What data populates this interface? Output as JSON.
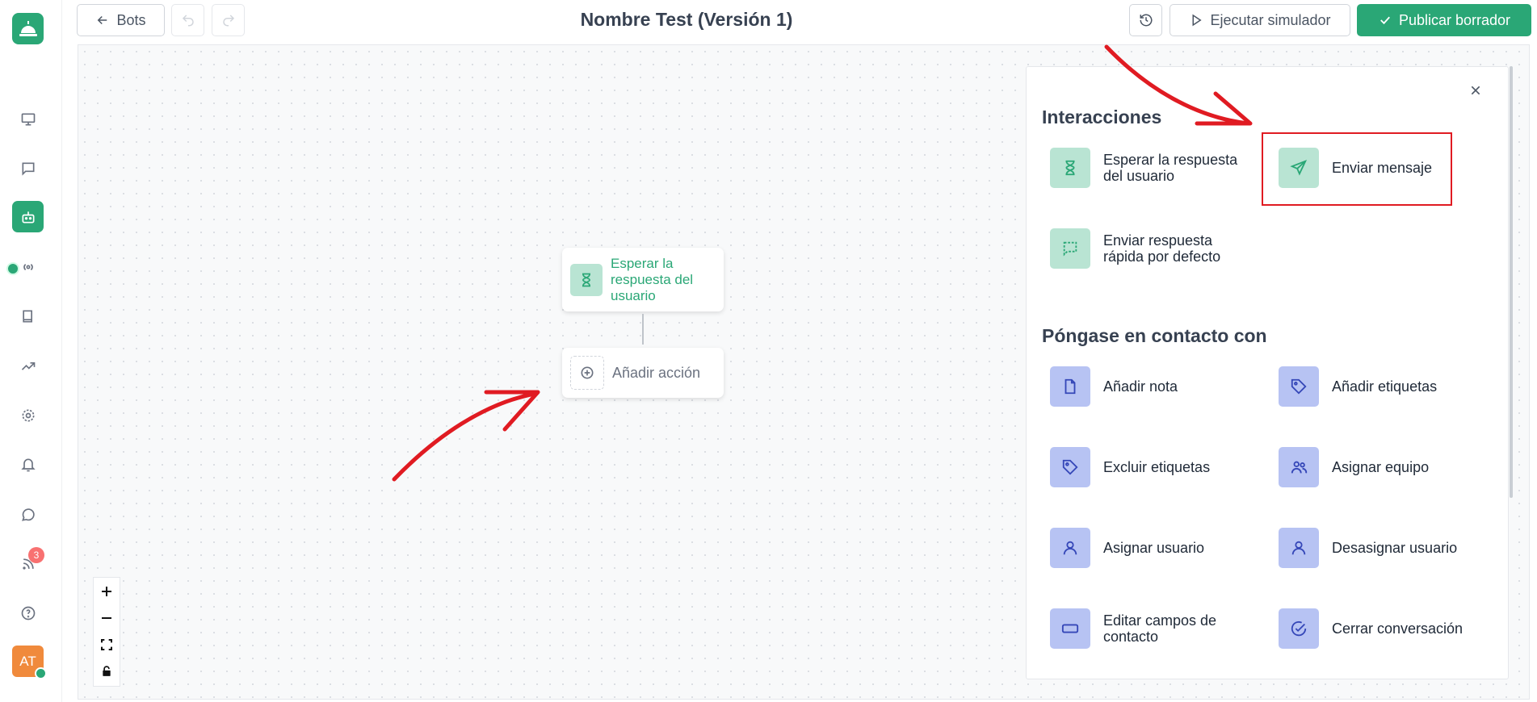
{
  "header": {
    "back_label": "Bots",
    "title": "Nombre Test (Versión 1)",
    "simulate_label": "Ejecutar simulador",
    "publish_label": "Publicar borrador"
  },
  "sidebar": {
    "logo": "bell-logo",
    "items": [
      {
        "icon": "monitor-icon"
      },
      {
        "icon": "chat-icon"
      },
      {
        "icon": "bot-icon",
        "active": true
      },
      {
        "icon": "broadcast-icon"
      },
      {
        "icon": "book-icon"
      },
      {
        "icon": "trend-icon"
      },
      {
        "icon": "gear-icon"
      },
      {
        "icon": "bell-icon"
      },
      {
        "icon": "whatsapp-icon"
      },
      {
        "icon": "feed-icon",
        "badge": "3"
      },
      {
        "icon": "help-icon"
      }
    ],
    "avatar_initials": "AT"
  },
  "canvas": {
    "nodes": [
      {
        "label": "Esperar la respuesta del usuario",
        "icon": "hourglass-icon"
      },
      {
        "label": "Añadir acción",
        "icon": "plus-circle-icon"
      }
    ],
    "zoom_controls": [
      "zoom-in",
      "zoom-out",
      "fit-view",
      "lock"
    ]
  },
  "panel": {
    "interactions_title": "Interacciones",
    "interactions": [
      {
        "label": "Esperar la respuesta del usuario",
        "icon": "hourglass-icon"
      },
      {
        "label": "Enviar mensaje",
        "icon": "send-icon"
      },
      {
        "label": "Enviar respuesta rápida por defecto",
        "icon": "quick-reply-icon"
      }
    ],
    "contact_title": "Póngase en contacto con",
    "contact_actions": [
      {
        "label": "Añadir nota",
        "icon": "note-icon"
      },
      {
        "label": "Añadir etiquetas",
        "icon": "tag-icon"
      },
      {
        "label": "Excluir etiquetas",
        "icon": "tag-icon"
      },
      {
        "label": "Asignar equipo",
        "icon": "team-icon"
      },
      {
        "label": "Asignar usuario",
        "icon": "user-icon"
      },
      {
        "label": "Desasignar usuario",
        "icon": "user-icon"
      },
      {
        "label": "Editar campos de contacto",
        "icon": "fields-icon"
      },
      {
        "label": "Cerrar conversación",
        "icon": "check-circle-icon"
      }
    ]
  },
  "colors": {
    "accent": "#2aa776",
    "annotation": "#e01b22"
  }
}
